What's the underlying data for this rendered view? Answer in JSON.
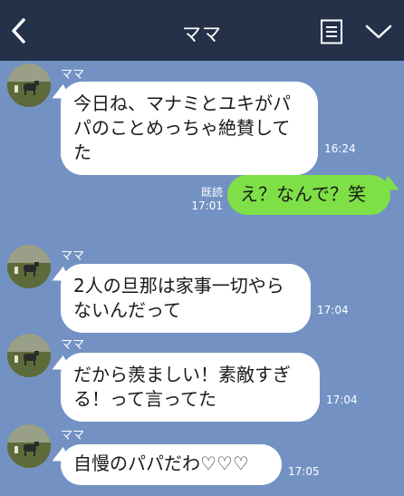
{
  "header": {
    "title": "ママ",
    "background": "#253049"
  },
  "colors": {
    "chat_background": "#7392c3",
    "incoming_bubble": "#ffffff",
    "outgoing_bubble": "#7ee046"
  },
  "messages": [
    {
      "sender": "ママ",
      "text": "今日ね、マナミとユキがパ\nパのことめっちゃ絶賛して\nた",
      "time": "16:24",
      "direction": "incoming"
    },
    {
      "text": "え？なんで？笑",
      "read_label": "既読",
      "time": "17:01",
      "direction": "outgoing"
    },
    {
      "sender": "ママ",
      "text": "2人の旦那は家事一切やら\nないんだって",
      "time": "17:04",
      "direction": "incoming"
    },
    {
      "sender": "ママ",
      "text": "だから羨ましい！素敵すぎ\nる！って言ってた",
      "time": "17:04",
      "direction": "incoming"
    },
    {
      "sender": "ママ",
      "text": "自慢のパパだわ♡♡♡",
      "time": "17:05",
      "direction": "incoming"
    }
  ]
}
